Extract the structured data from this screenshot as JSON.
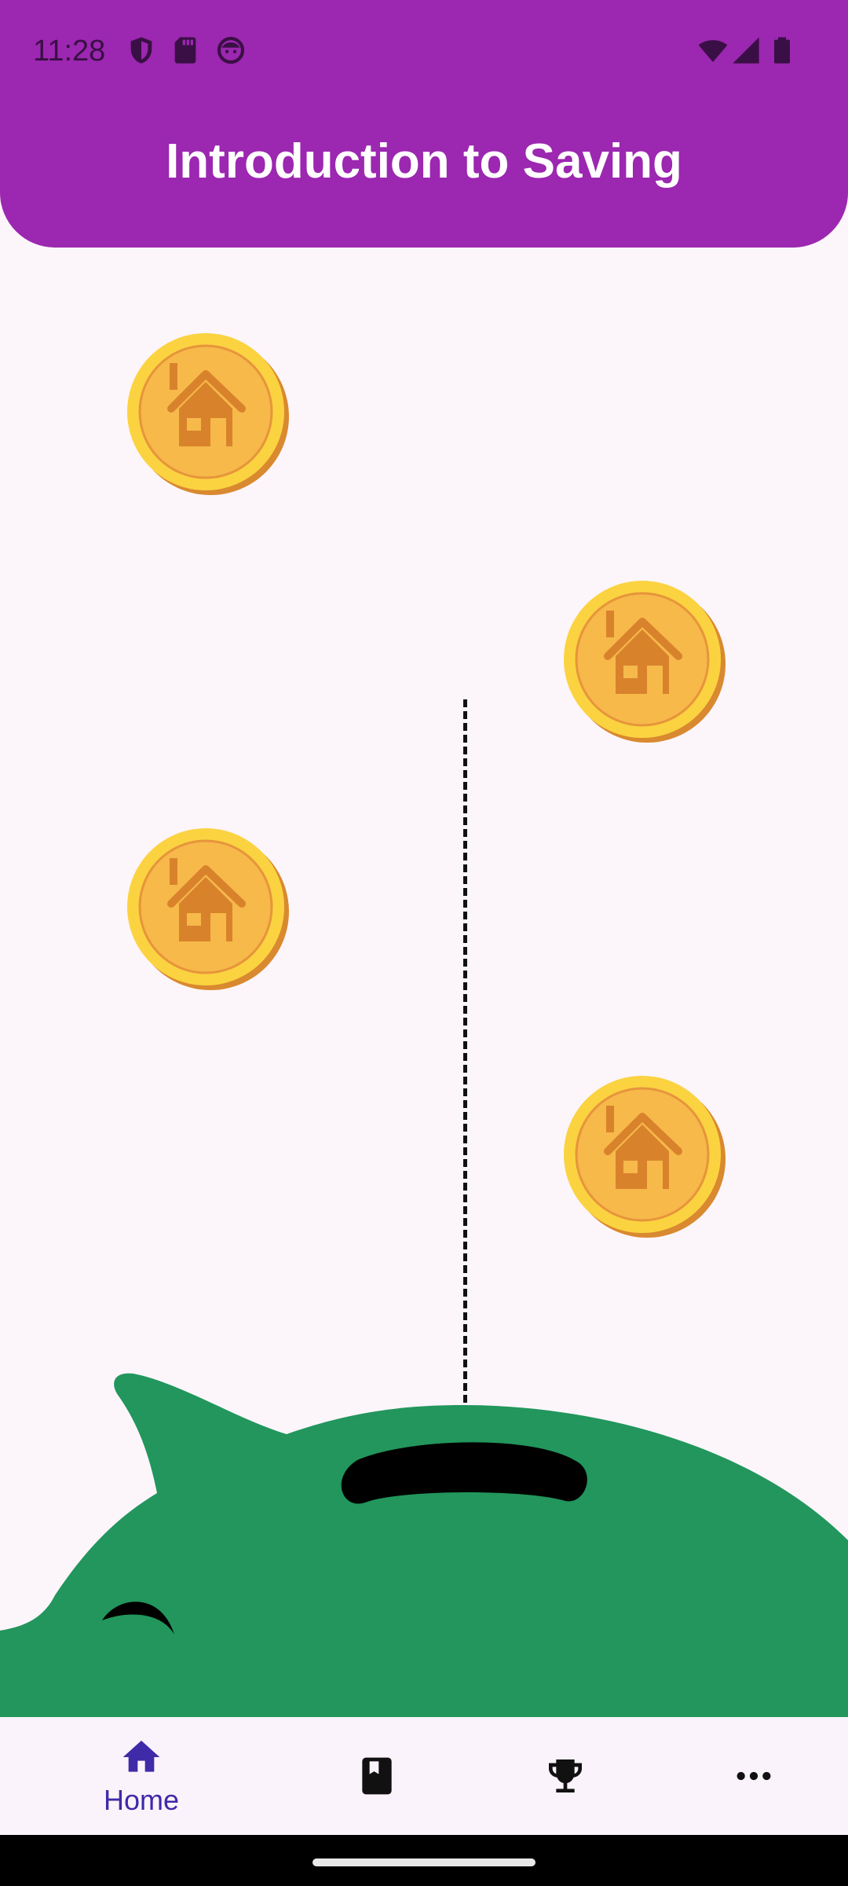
{
  "status_bar": {
    "time": "11:28",
    "left_icons": [
      "shield-icon",
      "sd-card-icon",
      "face-icon"
    ],
    "right_icons": [
      "wifi-icon",
      "signal-icon",
      "battery-icon"
    ]
  },
  "header": {
    "title": "Introduction to Saving",
    "color": "#9c27b0"
  },
  "lessons": [
    {
      "icon": "house-icon"
    },
    {
      "icon": "house-icon"
    },
    {
      "icon": "house-icon"
    },
    {
      "icon": "house-icon"
    }
  ],
  "piggy_bank": {
    "color": "#22965c"
  },
  "bottom_nav": {
    "items": [
      {
        "icon": "home-icon",
        "label": "Home",
        "selected": true
      },
      {
        "icon": "book-icon",
        "label": "",
        "selected": false
      },
      {
        "icon": "trophy-icon",
        "label": "",
        "selected": false
      },
      {
        "icon": "more-icon",
        "label": "",
        "selected": false
      }
    ]
  }
}
